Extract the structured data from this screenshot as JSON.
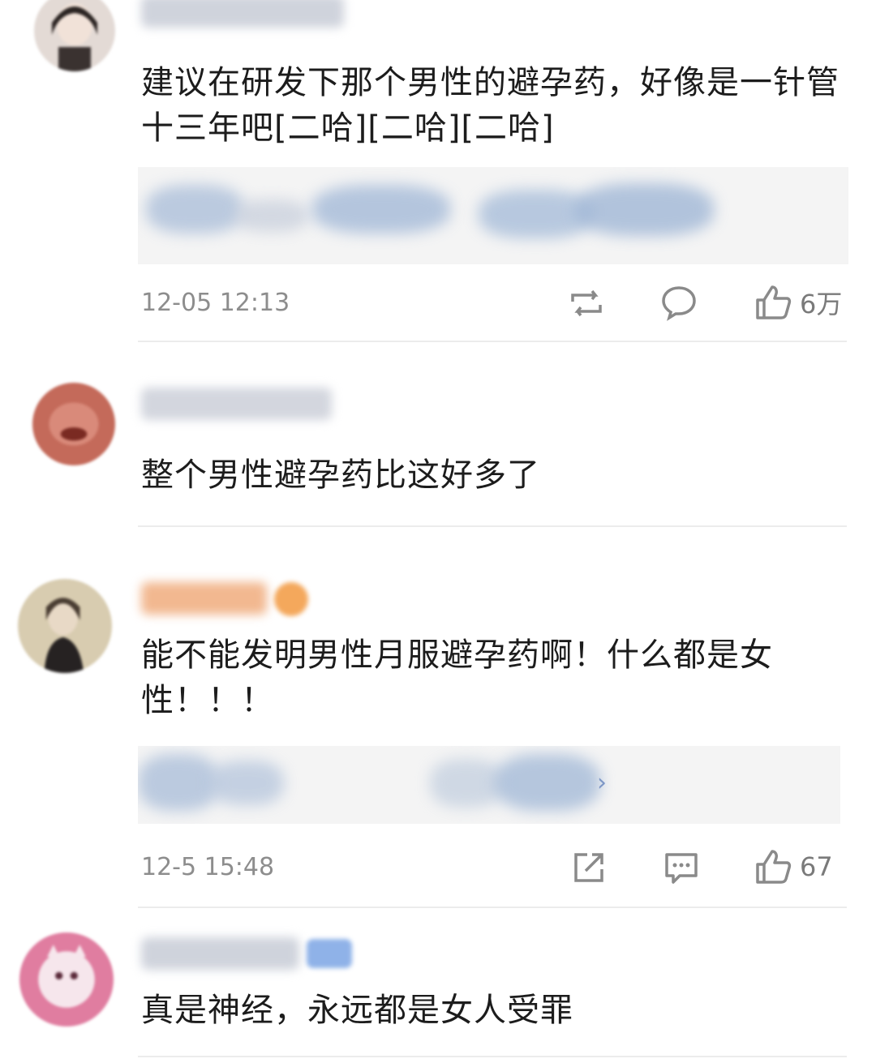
{
  "comments": [
    {
      "content": "建议在研发下那个男性的避孕药，好像是一针管十三年吧[二哈][二哈][二哈]",
      "time": "12-05 12:13",
      "likes": "6万",
      "avatar_color": "#d9c9c0",
      "icons": [
        "repost-icon",
        "comment-icon",
        "like-icon"
      ]
    },
    {
      "content": "整个男性避孕药比这好多了",
      "avatar_color": "#c46a5a"
    },
    {
      "content": "能不能发明男性月服避孕药啊！什么都是女性！！！",
      "time": "12-5 15:48",
      "likes": "67",
      "avatar_color": "#d8ccb0",
      "icons": [
        "share-icon",
        "comment-icon",
        "like-icon"
      ]
    },
    {
      "content": "真是神经，永远都是女人受罪",
      "avatar_color": "#e07da0"
    }
  ],
  "colors": {
    "username_blur": "#cfd3dc",
    "vip_username_blur": "#f2b890",
    "quote_blur": "#a8bcd8",
    "meta_text": "#8d8d8d"
  }
}
